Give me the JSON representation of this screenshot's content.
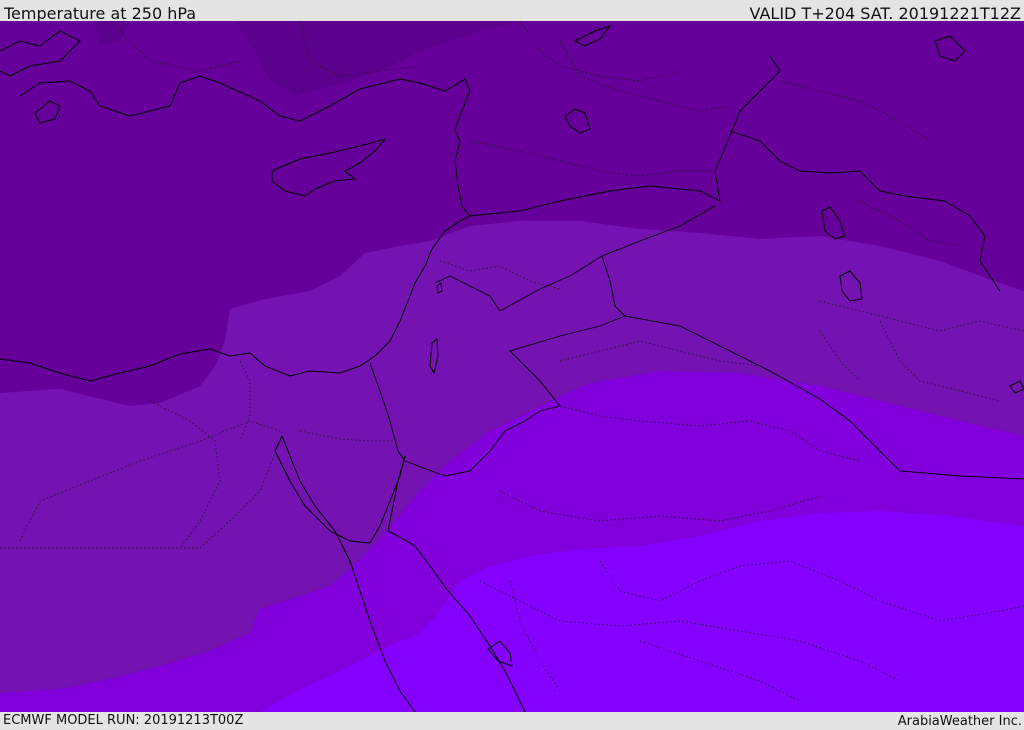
{
  "header": {
    "title": "Temperature at 250 hPa",
    "valid_time": "VALID T+204 SAT. 20191221T12Z"
  },
  "footer": {
    "model_run": "ECMWF MODEL RUN: 20191213T00Z",
    "credit": "ArabiaWeather Inc."
  },
  "map": {
    "colors": {
      "coldest": "#5b008c",
      "cold": "#65009a",
      "mid": "#7512b2",
      "warm": "#8100dc",
      "warmest": "#8400ff",
      "coast": "#000000"
    }
  }
}
